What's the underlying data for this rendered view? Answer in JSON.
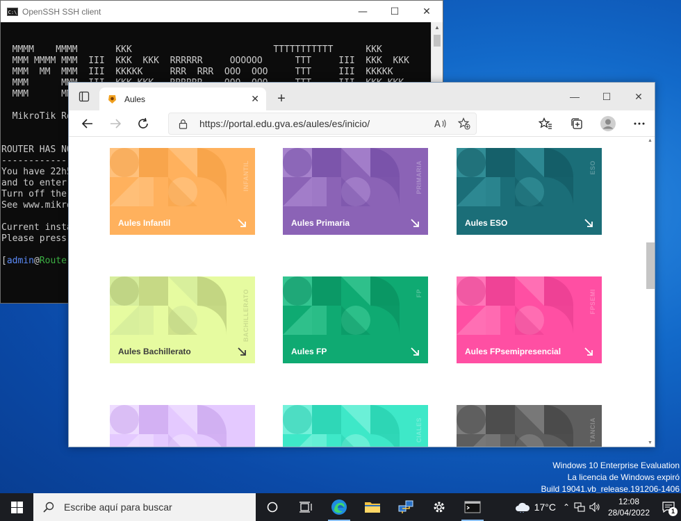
{
  "ssh": {
    "title": "OpenSSH SSH client",
    "lines": [
      "  MMMM    MMMM       KKK                          TTTTTTTTTTT      KKK",
      "  MMM MMMM MMM  III  KKK  KKK  RRRRRR     OOOOOO      TTT     III  KKK  KKK",
      "  MMM  MM  MMM  III  KKKKK     RRR  RRR  OOO  OOO     TTT     III  KKKKK",
      "  MMM      MMM  III  KKK KKK   RRRRRR    OOO  OOO     TTT     III  KKK KKK",
      "  MMM      MMM  III  KKK  KKK  RRR  RRR   OOOOOO      TTT     III  KKK  KKK",
      "",
      "  MikroTik RouterOS 7.2 (c) 1999-2022       https://www.mikrotik.com/",
      "",
      "",
      "ROUTER HAS NO SOFTWARE KEY",
      "----------------------------",
      "You have 22h54m to configure the router to be remotely accessible,",
      "and to enter the key by pasting it in a Telnet window or in Winbox.",
      "Turn off the device to stop the timer.",
      "See www.mikrotik.com/key for more details.",
      "",
      "Current installation \"software ID\": ABCD-1234",
      "Please press \"Enter\" to continue!",
      ""
    ],
    "prompt_user": "admin",
    "prompt_at": "@",
    "prompt_host": "RouterOS",
    "prompt_tail": "] > "
  },
  "browser": {
    "tab_title": "Aules",
    "url": "https://portal.edu.gva.es/aules/es/inicio/",
    "cards": [
      {
        "label": "Aules Infantil",
        "vertical": "INFANTIL",
        "bg": "#ffb15d",
        "shade": "#f29a3c",
        "light": "#ffc88a",
        "label_dark": false
      },
      {
        "label": "Aules Primaria",
        "vertical": "PRIMARIA",
        "bg": "#8b63b6",
        "shade": "#6d47a0",
        "light": "#b290d6",
        "label_dark": false
      },
      {
        "label": "Aules ESO",
        "vertical": "ESO",
        "bg": "#1b6e78",
        "shade": "#0f525b",
        "light": "#3a9aa3",
        "label_dark": false
      },
      {
        "label": "Aules Bachillerato",
        "vertical": "BACHILLERATO",
        "bg": "#e6fba0",
        "shade": "#a6b86a",
        "light": "#cfe79a",
        "label_dark": true
      },
      {
        "label": "Aules FP",
        "vertical": "FP",
        "bg": "#0faa72",
        "shade": "#07875a",
        "light": "#45cf9c",
        "label_dark": false
      },
      {
        "label": "Aules FPsemipresencial",
        "vertical": "FPSEMI",
        "bg": "#ff4fa3",
        "shade": "#e0378a",
        "light": "#ff86c0",
        "label_dark": false
      },
      {
        "label": "",
        "vertical": "",
        "bg": "#e4c9ff",
        "shade": "#c19ae8",
        "light": "#f2e4ff",
        "label_dark": false
      },
      {
        "label": "",
        "vertical": "CIALES",
        "bg": "#3ee8c8",
        "shade": "#1fc6a6",
        "light": "#8af5e1",
        "label_dark": false
      },
      {
        "label": "",
        "vertical": "TANCIA",
        "bg": "#5e5e5e",
        "shade": "#3c3c3c",
        "light": "#8a8a8a",
        "label_dark": false
      }
    ]
  },
  "watermark": {
    "line1": "Windows 10 Enterprise Evaluation",
    "line2": "La licencia de Windows expiró",
    "line3": "Build 19041.vb_release.191206-1406"
  },
  "taskbar": {
    "search_placeholder": "Escribe aquí para buscar",
    "temperature": "17°C",
    "time": "12:08",
    "date": "28/04/2022",
    "notification_count": "1"
  }
}
